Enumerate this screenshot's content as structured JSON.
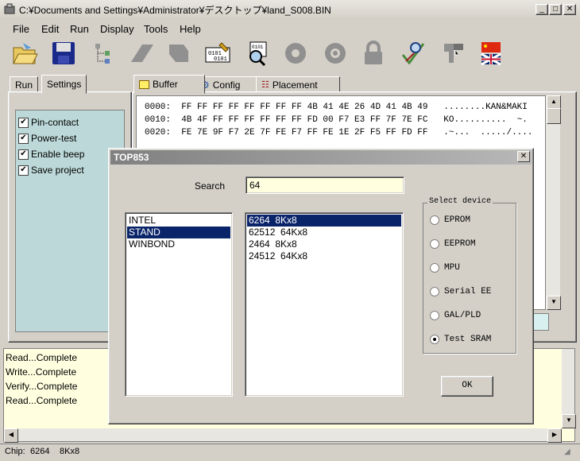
{
  "window": {
    "title": "C:¥Documents and Settings¥Administrator¥デスクトップ¥land_S008.BIN"
  },
  "menu": [
    "File",
    "Edit",
    "Run",
    "Display",
    "Tools",
    "Help"
  ],
  "left_tabs": [
    "Run",
    "Settings"
  ],
  "settings": [
    "Pin-contact",
    "Power-test",
    "Enable beep",
    "Save project"
  ],
  "right_tabs": [
    "Buffer",
    "Config",
    "Placement"
  ],
  "buffer": [
    "0000:  FF FF FF FF FF FF FF FF 4B 41 4E 26 4D 41 4B 49   ........KAN&MAKI",
    "0010:  4B 4F FF FF FF FF FF FF FD 00 F7 E3 FF 7F 7E FC   KO..........  ~.",
    "0020:  FE 7E 9F F7 2E 7F FE F7 FF FE 1E 2F F5 FF FD FF   .~...  ...../...."
  ],
  "log": [
    "Read...Complete",
    "Write...Complete",
    "Verify...Complete",
    "Read...Complete"
  ],
  "status": {
    "label": "Chip:",
    "chip": "6264",
    "size": "8Kx8"
  },
  "dialog": {
    "title": "TOP853",
    "search_label": "Search",
    "search_value": "64",
    "manufacturers": [
      "INTEL",
      "STAND",
      "WINBOND"
    ],
    "selected_manufacturer": 1,
    "devices": [
      "6264  8Kx8",
      "62512  64Kx8",
      "2464  8Kx8",
      "24512  64Kx8"
    ],
    "selected_device": 0,
    "group_label": "Select device",
    "device_types": [
      "EPROM",
      "EEPROM",
      "MPU",
      "Serial EE",
      "GAL/PLD",
      "Test SRAM"
    ],
    "selected_type": 5,
    "ok_label": "OK"
  }
}
